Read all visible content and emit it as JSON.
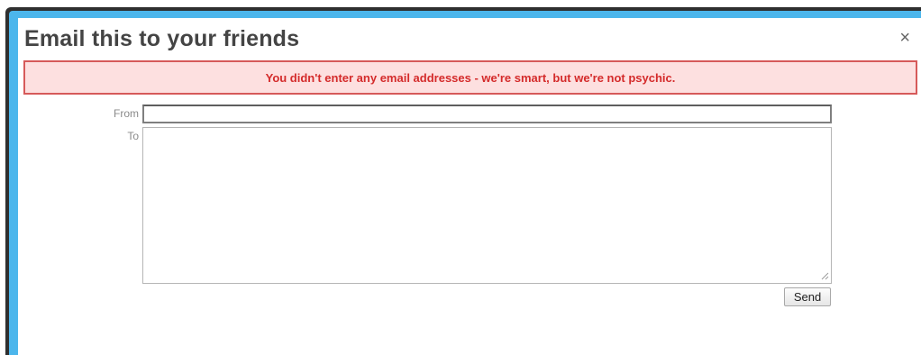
{
  "dialog": {
    "title": "Email this to your friends",
    "close_label": "×"
  },
  "error": {
    "message": "You didn't enter any email addresses - we're smart, but we're not psychic."
  },
  "form": {
    "from_label": "From",
    "from_value": "",
    "to_label": "To",
    "to_value": "",
    "send_label": "Send"
  },
  "colors": {
    "error_text": "#d42b2b",
    "error_bg": "#fde0e0",
    "error_border": "#d65a5a",
    "accent_edge": "#4cb6ec"
  }
}
